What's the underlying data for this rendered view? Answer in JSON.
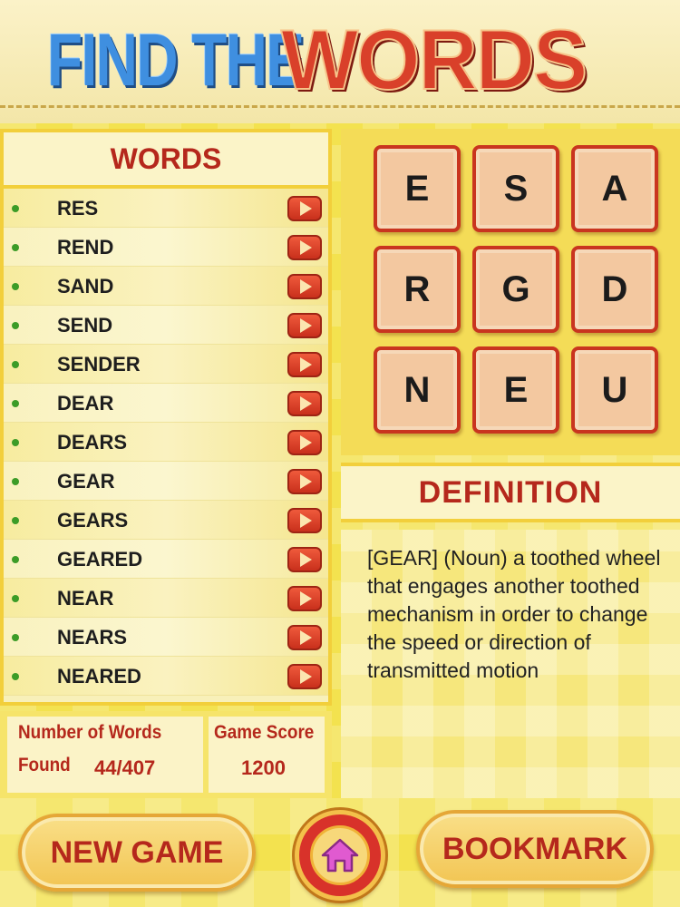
{
  "header": {
    "title_part1": "FIND THE",
    "title_part2": "WORDS"
  },
  "words_panel": {
    "heading": "WORDS",
    "items": [
      {
        "word": "RES"
      },
      {
        "word": "REND"
      },
      {
        "word": "SAND"
      },
      {
        "word": "SEND"
      },
      {
        "word": "SENDER"
      },
      {
        "word": "DEAR"
      },
      {
        "word": "DEARS"
      },
      {
        "word": "GEAR"
      },
      {
        "word": "GEARS"
      },
      {
        "word": "GEARED"
      },
      {
        "word": "NEAR"
      },
      {
        "word": "NEARS"
      },
      {
        "word": "NEARED"
      }
    ],
    "play_icon": "play-icon",
    "bullet_color": "#3c9c27"
  },
  "stats": {
    "words_label_line1": "Number of Words",
    "words_label_line2": "Found",
    "words_found": "44/407",
    "score_label": "Game Score",
    "score_value": "1200"
  },
  "grid": {
    "letters": [
      [
        "E",
        "S",
        "A"
      ],
      [
        "R",
        "G",
        "D"
      ],
      [
        "N",
        "E",
        "U"
      ]
    ]
  },
  "definition": {
    "heading": "DEFINITION",
    "text": "[GEAR] (Noun) a toothed wheel that engages another toothed mechanism in order to change the speed or direction of transmitted motion"
  },
  "buttons": {
    "new_game": "NEW GAME",
    "bookmark": "BOOKMARK",
    "home_icon": "home-icon"
  },
  "colors": {
    "accent_red": "#b5281c",
    "title_blue": "#3f8fe0",
    "title_red": "#d9402a",
    "home_icon_pink": "#e05ad0"
  }
}
